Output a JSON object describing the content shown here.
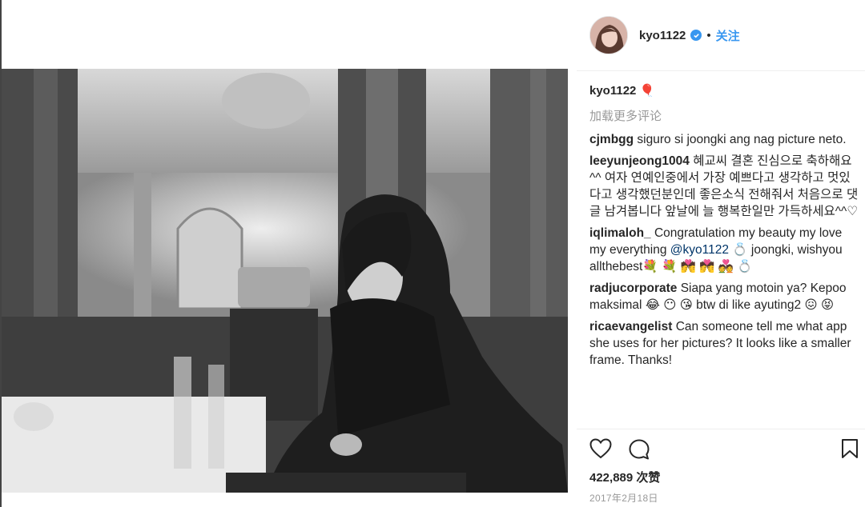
{
  "post": {
    "author": "kyo1122",
    "follow_label": "关注",
    "dot": "•",
    "caption_user": "kyo1122",
    "caption_emoji": "🎈",
    "load_more_label": "加载更多评论",
    "likes_text": "422,889 次赞",
    "date_text": "2017年2月18日"
  },
  "comments": [
    {
      "user": "cjmbgg",
      "text": " siguro si joongki ang nag picture neto."
    },
    {
      "user": "leeyunjeong1004",
      "text": " 혜교씨 결혼 진심으로 축하해요^^ 여자 연예인중에서 가장 예쁘다고 생각하고 멋있다고 생각했던분인데 좋은소식 전해줘서 처음으로 댓글 남겨봅니다 앞날에 늘 행복한일만 가득하세요^^♡"
    },
    {
      "user": "iqlimaloh_",
      "text_before": " Congratulation my beauty my love my everything ",
      "mention": "@kyo1122",
      "text_after": " 💍 joongki, wishyou allthebest💐 💐 💏 💏 💑 💍"
    },
    {
      "user": "radjucorporate",
      "text": " Siapa yang motoin ya? Kepoo maksimal 😂 😶 😘  btw di like ayuting2 😖 😝"
    },
    {
      "user": "ricaevangelist",
      "text": " Can someone tell me what app she uses for her pictures? It looks like a smaller frame. Thanks!"
    }
  ],
  "icons": {
    "like": "heart-icon",
    "comment": "comment-bubble-icon",
    "save": "bookmark-icon",
    "verified": "verified-badge-icon"
  },
  "colors": {
    "link_blue": "#3897f0",
    "mention_blue": "#003569",
    "muted": "#999999",
    "text": "#262626"
  }
}
